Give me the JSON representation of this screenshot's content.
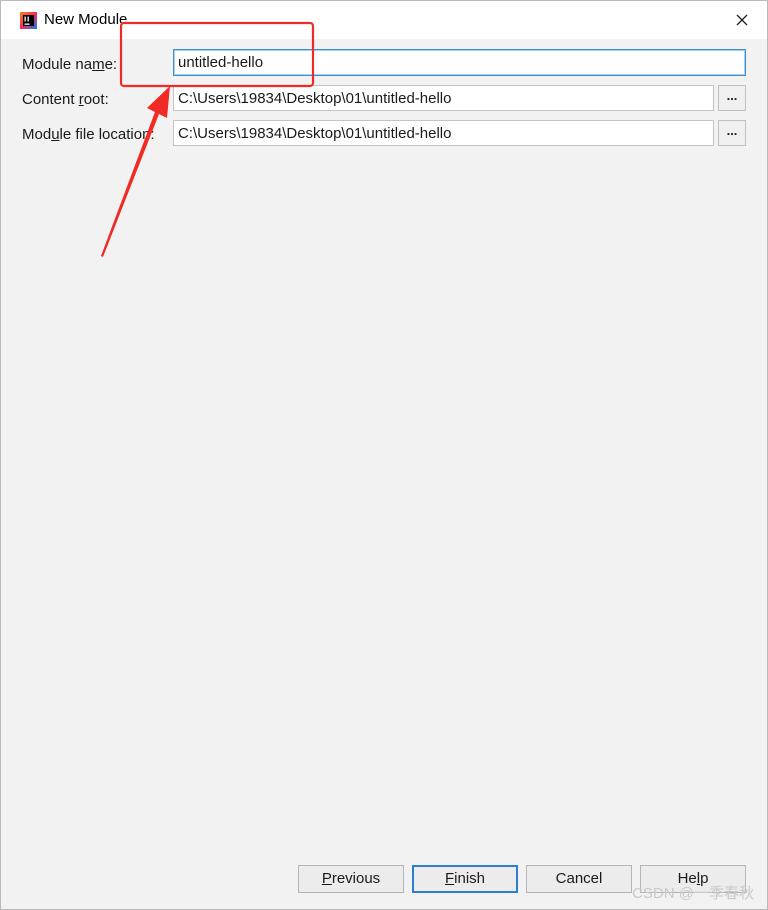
{
  "window": {
    "title": "New Module",
    "close_glyph": "✕"
  },
  "form": {
    "module_name": {
      "label_before": "Module na",
      "label_mnemonic": "m",
      "label_after": "e:",
      "value": "untitled-hello"
    },
    "content_root": {
      "label_before": "Content ",
      "label_mnemonic": "r",
      "label_after": "oot:",
      "value": "C:\\Users\\19834\\Desktop\\01\\untitled-hello",
      "browse_label": "..."
    },
    "module_file_location": {
      "label_before": "Mod",
      "label_mnemonic": "u",
      "label_after": "le file location:",
      "value": "C:\\Users\\19834\\Desktop\\01\\untitled-hello",
      "browse_label": "..."
    }
  },
  "footer": {
    "previous": {
      "mnemonic": "P",
      "rest": "revious"
    },
    "finish": {
      "mnemonic": "F",
      "rest": "inish"
    },
    "cancel": "Cancel",
    "help": {
      "before": "He",
      "mnemonic": "l",
      "after": "p"
    }
  },
  "annotation": {
    "color": "#f02a24"
  },
  "watermark": "CSDN @一季春秋"
}
